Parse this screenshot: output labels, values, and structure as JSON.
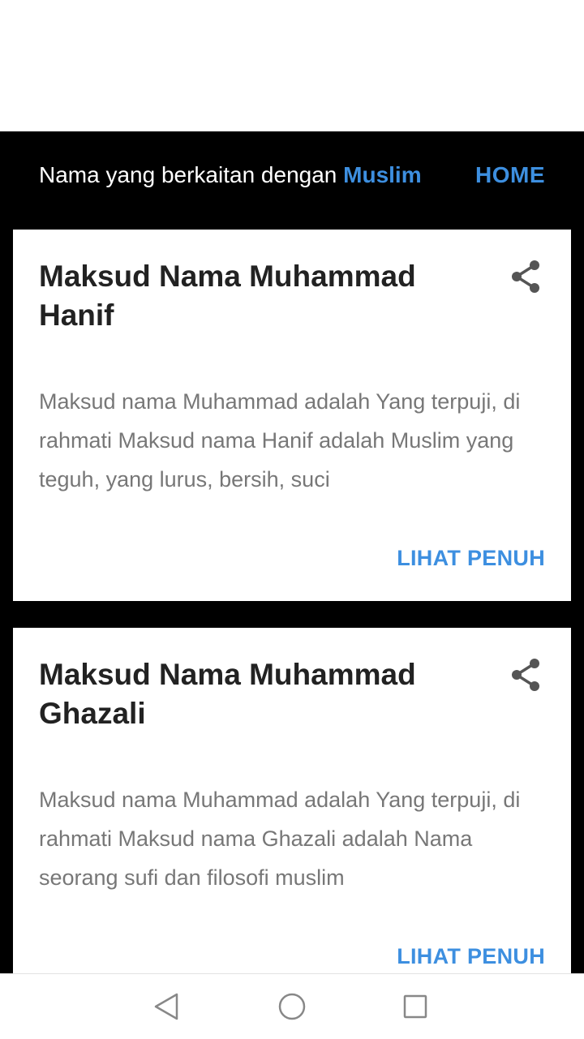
{
  "header": {
    "text": "Nama yang berkaitan dengan",
    "category": "Muslim",
    "home_label": "HOME"
  },
  "cards": [
    {
      "title": "Maksud Nama Muhammad Hanif",
      "description": "Maksud nama Muhammad adalah Yang terpuji, di rahmati Maksud nama Hanif adalah Muslim yang teguh, yang lurus, bersih, suci",
      "link_label": "LIHAT PENUH"
    },
    {
      "title": "Maksud Nama Muhammad Ghazali",
      "description": "Maksud nama Muhammad adalah Yang terpuji, di rahmati Maksud nama Ghazali adalah Nama seorang sufi dan filosofi muslim",
      "link_label": "LIHAT PENUH"
    }
  ],
  "icons": {
    "share": "share-icon",
    "nav_back": "back-triangle-icon",
    "nav_home": "home-circle-icon",
    "nav_recents": "recents-square-icon"
  },
  "colors": {
    "accent": "#3d8fe0",
    "background": "#000000",
    "card": "#ffffff",
    "title": "#222222",
    "description": "#777777"
  }
}
